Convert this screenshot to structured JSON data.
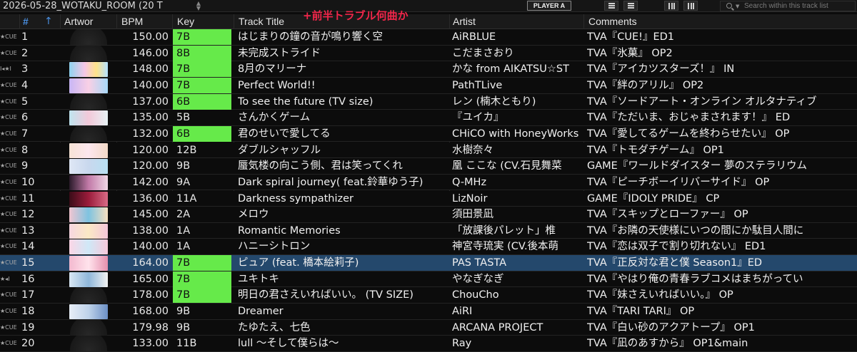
{
  "toolbar": {
    "playlist_title": "2026-05-28_WOTAKU_ROOM (20 T",
    "player_button": "PLAYER A",
    "search_placeholder": "Search within this track list"
  },
  "annotation": "+前半トラブル何曲か",
  "columns": {
    "num": "#",
    "artwork": "Artwor",
    "bpm": "BPM",
    "key": "Key",
    "title": "Track Title",
    "artist": "Artist",
    "comments": "Comments"
  },
  "colors": {
    "key_highlight": "#66ea4a",
    "selected_row": "#24486c",
    "annotation": "#f2264a",
    "header_accent": "#4a90e2"
  },
  "tracks": [
    {
      "mark": "★CUE",
      "num": "1",
      "bpm": "150.00",
      "key": "7B",
      "key_hl": true,
      "title": "はじまりの鐘の音が鳴り響く空",
      "artist": "AiRBLUE",
      "comment": "TVA『CUE!』ED1",
      "art": "disc"
    },
    {
      "mark": "★CUE",
      "num": "2",
      "bpm": "146.00",
      "key": "8B",
      "key_hl": true,
      "title": "未完成ストライド",
      "artist": "こだまさおり",
      "comment": "TVA『氷菓』 OP2",
      "art": "disc"
    },
    {
      "mark": "I◂★I",
      "num": "3",
      "bpm": "148.00",
      "key": "7B",
      "key_hl": true,
      "title": "8月のマリーナ",
      "artist": "かな from AIKATSU☆ST",
      "comment": "TVA『アイカツスターズ！』 IN",
      "art": "aikatsu"
    },
    {
      "mark": "★CUE",
      "num": "4",
      "bpm": "140.00",
      "key": "7B",
      "key_hl": true,
      "title": "Perfect World!!",
      "artist": "PathTLive",
      "comment": "TVA『絆のアリル』 OP2",
      "art": "aril"
    },
    {
      "mark": "★CUE",
      "num": "5",
      "bpm": "137.00",
      "key": "6B",
      "key_hl": true,
      "title": "To see the future (TV size)",
      "artist": "レン (楠木ともり)",
      "comment": "TVA『ソードアート・オンライン オルタナティブ",
      "art": "disc"
    },
    {
      "mark": "★CUE",
      "num": "6",
      "bpm": "135.00",
      "key": "5B",
      "key_hl": false,
      "title": "さんかくゲーム",
      "artist": "『ユイカ』",
      "comment": "TVA『ただいま、おじゃまされます！』 ED",
      "art": "heart"
    },
    {
      "mark": "★CUE",
      "num": "7",
      "bpm": "132.00",
      "key": "6B",
      "key_hl": true,
      "title": "君のせいで愛してる",
      "artist": "CHiCO with HoneyWorks",
      "comment": "TVA『愛してるゲームを終わらせたい』 OP",
      "art": "disc"
    },
    {
      "mark": "★CUE",
      "num": "8",
      "bpm": "120.00",
      "key": "12B",
      "key_hl": false,
      "title": "ダブルシャッフル",
      "artist": "水樹奈々",
      "comment": "TVA『トモダチゲーム』 OP1",
      "art": "double"
    },
    {
      "mark": "★CUE",
      "num": "9",
      "bpm": "120.00",
      "key": "9B",
      "key_hl": false,
      "title": "蜃気楼の向こう側、君は笑ってくれ",
      "artist": "凰 ここな (CV.石見舞菜",
      "comment": "GAME『ワールドダイスター 夢のステラリウム",
      "art": "stella"
    },
    {
      "mark": "★CUE",
      "num": "10",
      "bpm": "142.00",
      "key": "9A",
      "key_hl": false,
      "title": "Dark spiral journey( feat.鈴華ゆう子)",
      "artist": "Q-MHz",
      "comment": "TVA『ピーチボーイリバーサイド』 OP",
      "art": "peach"
    },
    {
      "mark": "★CUE",
      "num": "11",
      "bpm": "136.00",
      "key": "11A",
      "key_hl": false,
      "title": "Darkness sympathizer",
      "artist": "LizNoir",
      "comment": "GAME『IDOLY PRIDE』 CP",
      "art": "liznoir"
    },
    {
      "mark": "★CUE",
      "num": "12",
      "bpm": "145.00",
      "key": "2A",
      "key_hl": false,
      "title": "メロウ",
      "artist": "須田景凪",
      "comment": "TVA『スキップとローファー』 OP",
      "art": "skip"
    },
    {
      "mark": "★CUE",
      "num": "13",
      "bpm": "138.00",
      "key": "1A",
      "key_hl": false,
      "title": "Romantic Memories",
      "artist": "「放課後パレット」椎",
      "comment": "TVA『お隣の天使様にいつの間にか駄目人間に",
      "art": "angel"
    },
    {
      "mark": "★CUE",
      "num": "14",
      "bpm": "140.00",
      "key": "1A",
      "key_hl": false,
      "title": "ハニーシトロン",
      "artist": "神宮寺琉実 (CV.後本萌",
      "comment": "TVA『恋は双子で割り切れない』 ED1",
      "art": "twins"
    },
    {
      "mark": "★CUE",
      "num": "15",
      "bpm": "164.00",
      "key": "7B",
      "key_hl": true,
      "title": "ピュア (feat. 橋本絵莉子)",
      "artist": "PAS TASTA",
      "comment": "TVA『正反対な君と僕 Season1』ED",
      "art": "pure",
      "selected": true
    },
    {
      "mark": "★◂I",
      "num": "16",
      "bpm": "165.00",
      "key": "7B",
      "key_hl": true,
      "title": "ユキトキ",
      "artist": "やなぎなぎ",
      "comment": "TVA『やはり俺の青春ラブコメはまちがってい",
      "art": "yukitoki"
    },
    {
      "mark": "★CUE",
      "num": "17",
      "bpm": "178.00",
      "key": "7B",
      "key_hl": true,
      "title": "明日の君さえいればいい。 (TV SIZE)",
      "artist": "ChouCho",
      "comment": "TVA『妹さえいればいい。』 OP",
      "art": "disc"
    },
    {
      "mark": "★CUE",
      "num": "18",
      "bpm": "168.00",
      "key": "9B",
      "key_hl": false,
      "title": "Dreamer",
      "artist": "AiRI",
      "comment": "TVA『TARI TARI』 OP",
      "art": "dreamer"
    },
    {
      "mark": "★CUE",
      "num": "19",
      "bpm": "179.98",
      "key": "9B",
      "key_hl": false,
      "title": "たゆたえ、七色",
      "artist": "ARCANA PROJECT",
      "comment": "TVA『白い砂のアクアトープ』 OP1",
      "art": "disc"
    },
    {
      "mark": "★CUE",
      "num": "20",
      "bpm": "133.00",
      "key": "11B",
      "key_hl": false,
      "title": "lull 〜そして僕らは〜",
      "artist": "Ray",
      "comment": "TVA『凪のあすから』 OP1&main",
      "art": "disc"
    }
  ]
}
